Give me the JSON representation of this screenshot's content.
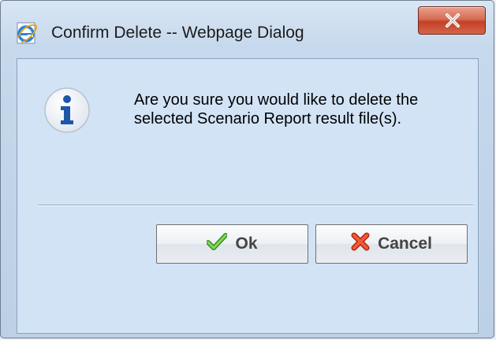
{
  "window": {
    "title": "Confirm Delete -- Webpage Dialog"
  },
  "dialog": {
    "message_line1": "Are you sure you would like to delete the",
    "message_line2": "selected Scenario Report result file(s)."
  },
  "buttons": {
    "ok_label": "Ok",
    "cancel_label": "Cancel"
  },
  "icons": {
    "app": "internet-explorer-icon",
    "close": "close-icon",
    "info": "info-icon",
    "ok": "checkmark-icon",
    "cancel": "cross-icon"
  },
  "colors": {
    "close_button": "#c34126",
    "info_blue": "#1f56a8",
    "ok_green": "#4caf32",
    "cancel_red": "#e03a1c"
  }
}
